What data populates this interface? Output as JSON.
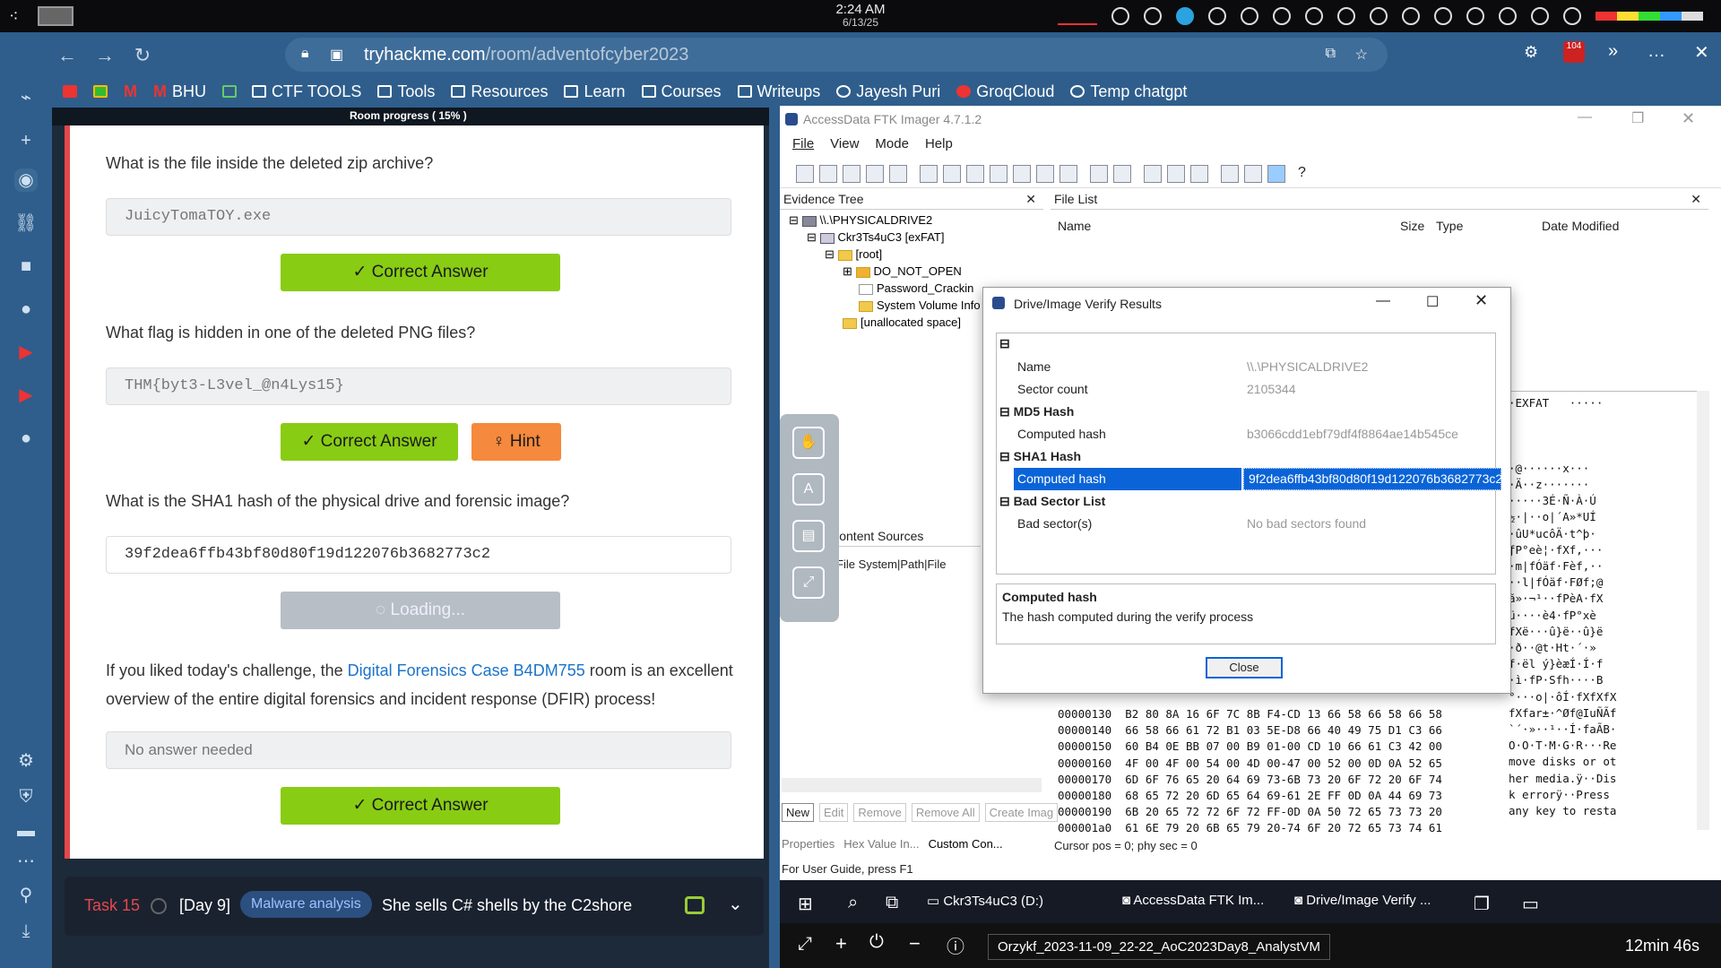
{
  "os": {
    "time": "2:24 AM",
    "date": "6/13/25"
  },
  "browser": {
    "url_host": "tryhackme.com",
    "url_path": "/room/adventofcyber2023",
    "badge": "104",
    "bookmarks": [
      "BHU",
      "CTF TOOLS",
      "Tools",
      "Resources",
      "Learn",
      "Courses",
      "Writeups",
      "Jayesh Puri",
      "GroqCloud",
      "Temp chatgpt"
    ]
  },
  "room": {
    "progress": "Room progress ( 15% )",
    "questions": [
      {
        "q": "What is the file inside the deleted zip archive?",
        "a": "JuicyTomaTOY.exe",
        "btn": "✓ Correct Answer"
      },
      {
        "q": "What flag is hidden in one of the deleted PNG files?",
        "a": "THM{byt3-L3vel_@n4Lys15}",
        "btn": "✓ Correct Answer",
        "hint": "♀ Hint"
      },
      {
        "q": "What is the SHA1 hash of the physical drive and forensic image?",
        "a": "39f2dea6ffb43bf80d80f19d122076b3682773c2",
        "btn": "◌ Loading..."
      }
    ],
    "para_prefix": "If you liked today's challenge, the ",
    "para_link": "Digital Forensics Case B4DM755",
    "para_suffix": " room is an excellent overview of the entire digital forensics and incident response (DFIR) process!",
    "no_answer": "No answer needed",
    "final_btn": "✓ Correct Answer",
    "task": {
      "num": "Task 15",
      "day": "[Day 9]",
      "tag": "Malware analysis",
      "title": "She sells C# shells by the C2shore"
    }
  },
  "ftk": {
    "title": "AccessData FTK Imager 4.7.1.2",
    "menu": [
      "File",
      "View",
      "Mode",
      "Help"
    ],
    "evidence_tree_title": "Evidence Tree",
    "file_list_title": "File List",
    "columns": [
      "Name",
      "Size",
      "Type",
      "Date Modified"
    ],
    "tree": [
      "\\\\.\\PHYSICALDRIVE2",
      "Ckr3Ts4uC3 [exFAT]",
      "[root]",
      "DO_NOT_OPEN",
      "Password_Crackin",
      "System Volume Info",
      "[unallocated space]"
    ],
    "custom_sources": "Custom Content Sources",
    "custom_cols": "Evidence:File System|Path|File",
    "custom_buttons": [
      "New",
      "Edit",
      "Remove",
      "Remove All",
      "Create Imag"
    ],
    "bottom_tabs": [
      "Properties",
      "Hex Value In...",
      "Custom Con..."
    ],
    "cursor_status": "Cursor pos = 0; phy sec = 0",
    "status": "For User Guide, press F1",
    "hex_rows": [
      "00000130  B2 80 8A 16 6F 7C 8B F4-CD 13 66 58 66 58 66 58",
      "00000140  66 58 66 61 72 B1 03 5E-D8 66 40 49 75 D1 C3 66",
      "00000150  60 B4 0E BB 07 00 B9 01-00 CD 10 66 61 C3 42 00",
      "00000160  4F 00 4F 00 54 00 4D 00-47 00 52 00 0D 0A 52 65",
      "00000170  6D 6F 76 65 20 64 69 73-6B 73 20 6F 72 20 6F 74",
      "00000180  68 65 72 20 6D 65 64 69-61 2E FF 0D 0A 44 69 73",
      "00000190  6B 20 65 72 72 6F 72 FF-0D 0A 50 72 65 73 73 20",
      "000001a0  61 6E 79 20 6B 65 79 20-74 6F 20 72 65 73 74 61"
    ],
    "hex_text": [
      "·EXFAT   ·····",
      "",
      "",
      "",
      "·@······x···",
      "·Ä··z·······",
      "·····3É·Ñ·À·Ú",
      "½·|··o|´A»*UÍ",
      "·ûU*ucôÄ·t^þ·",
      "ƒP°eè¦·fXf,···",
      "·m|fÓäf·Fèf,··",
      "··l|fÓäf·FØf;@",
      "ã»·¬¹··fPèA·fX",
      "ü····è4·fP°xè",
      "fXë···û}ë··û}ë",
      "·ð··@t·Ht·´·»",
      "f·ël ý}èæÍ·Í·f",
      "·ì·fP·Sfh····B",
      "°···o|·ôÍ·fXfXfX",
      "fXfar±·^Øf@IuÑÃf",
      "`´·»··¹··Í·faÃB·",
      "O·O·T·M·G·R···Re",
      "move disks or ot",
      "her media.ÿ··Dis",
      "k errorÿ··Press ",
      "any key to resta"
    ]
  },
  "dialog": {
    "title": "Drive/Image Verify Results",
    "name_label": "Name",
    "name_value": "\\\\.\\PHYSICALDRIVE2",
    "sector_label": "Sector count",
    "sector_value": "2105344",
    "md5_section": "MD5 Hash",
    "md5_label": "Computed hash",
    "md5_value": "b3066cdd1ebf79df4f8864ae14b545ce",
    "sha1_section": "SHA1 Hash",
    "sha1_label": "Computed hash",
    "sha1_value": "9f2dea6ffb43bf80d80f19d122076b3682773c2",
    "bad_section": "Bad Sector List",
    "bad_label": "Bad sector(s)",
    "bad_value": "No bad sectors found",
    "desc_title": "Computed hash",
    "desc_text": "The hash computed during the verify process",
    "close": "Close"
  },
  "taskbar": {
    "items": [
      "Ckr3Ts4uC3 (D:)",
      "AccessData FTK Im...",
      "Drive/Image Verify ..."
    ]
  },
  "vmbar": {
    "name": "Orzykf_2023-11-09_22-22_AoC2023Day8_AnalystVM",
    "timer": "12min 46s"
  }
}
